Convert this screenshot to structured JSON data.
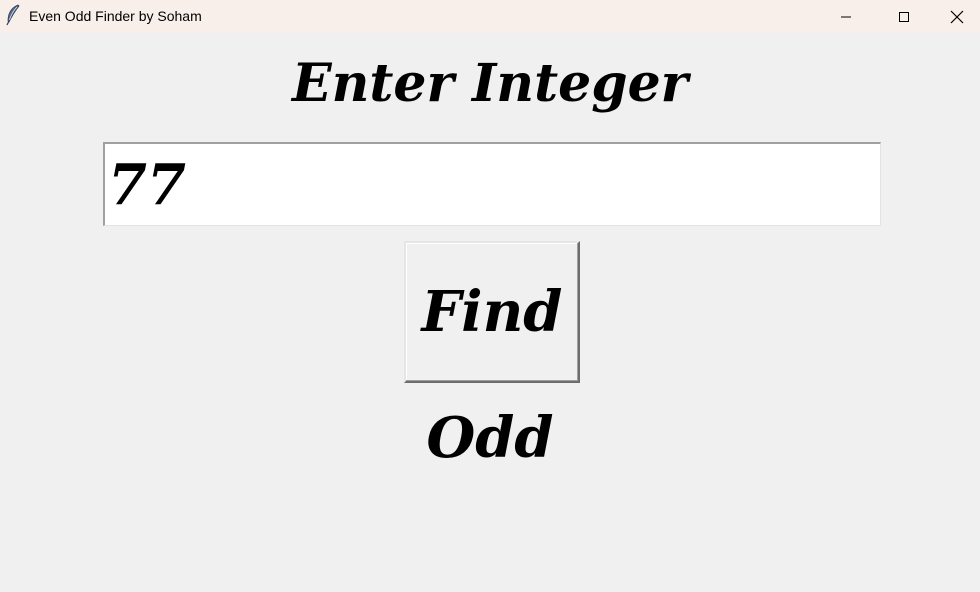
{
  "window": {
    "title": "Even Odd Finder by Soham",
    "icon": "feather-icon",
    "controls": {
      "minimize_icon": "minimize-icon",
      "maximize_icon": "maximize-icon",
      "close_icon": "close-icon"
    },
    "titlebar_color": "#f8efeb"
  },
  "main": {
    "heading": "Enter Integer",
    "input": {
      "value": "77"
    },
    "find_button": {
      "label": "Find"
    },
    "result": "Odd",
    "background_color": "#f0f0f0"
  }
}
